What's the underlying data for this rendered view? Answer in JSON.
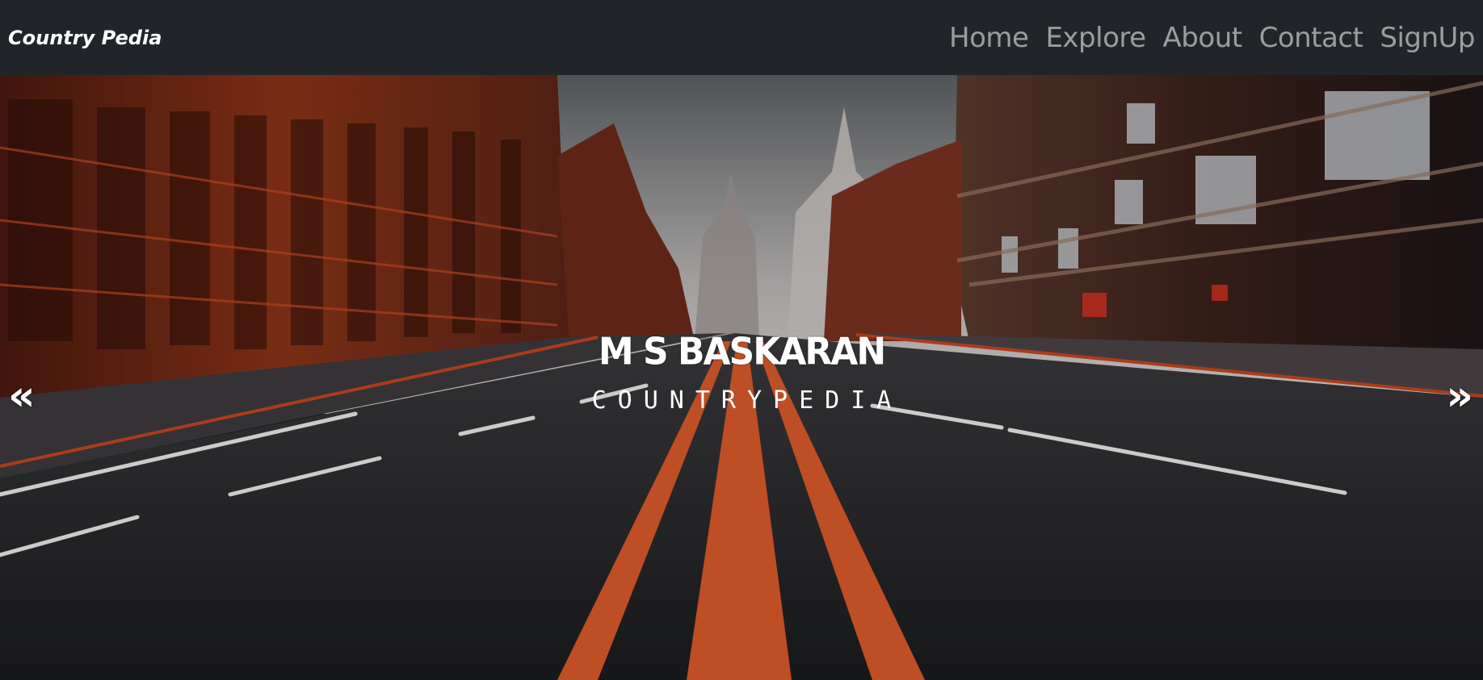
{
  "navbar": {
    "brand": "Country Pedia",
    "links": [
      {
        "label": "Home"
      },
      {
        "label": "Explore"
      },
      {
        "label": "About"
      },
      {
        "label": "Contact"
      },
      {
        "label": "SignUp"
      }
    ]
  },
  "hero": {
    "title": "M S BASKARAN",
    "subtitle": "COUNTRYPEDIA",
    "prev_icon": "double-chevron-left-icon",
    "next_icon": "double-chevron-right-icon",
    "prev_glyph": "«",
    "next_glyph": "»",
    "accent_color": "#e0582a"
  }
}
